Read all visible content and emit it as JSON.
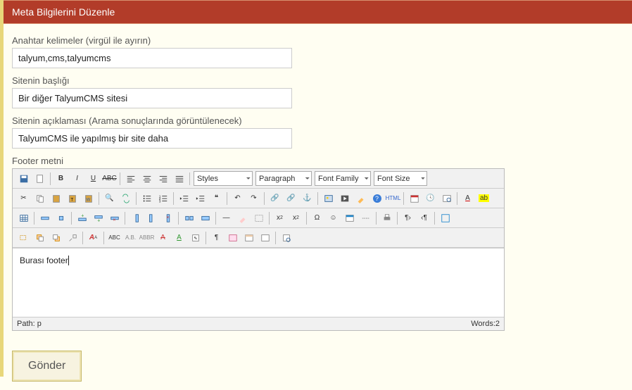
{
  "header": {
    "title": "Meta Bilgilerini Düzenle"
  },
  "fields": {
    "keywords": {
      "label": "Anahtar kelimeler (virgül ile ayırın)",
      "value": "talyum,cms,talyumcms"
    },
    "site_title": {
      "label": "Sitenin başlığı",
      "value": "Bir diğer TalyumCMS sitesi"
    },
    "site_desc": {
      "label": "Sitenin açıklaması (Arama sonuçlarında görüntülenecek)",
      "value": "TalyumCMS ile yapılmış bir site daha"
    },
    "footer": {
      "label": "Footer metni"
    }
  },
  "editor": {
    "selects": {
      "styles": "Styles",
      "paragraph": "Paragraph",
      "fontfamily": "Font Family",
      "fontsize": "Font Size"
    },
    "content": "Burası footer",
    "path_label": "Path: p",
    "words_label": "Words:2"
  },
  "submit": {
    "label": "Gönder"
  }
}
